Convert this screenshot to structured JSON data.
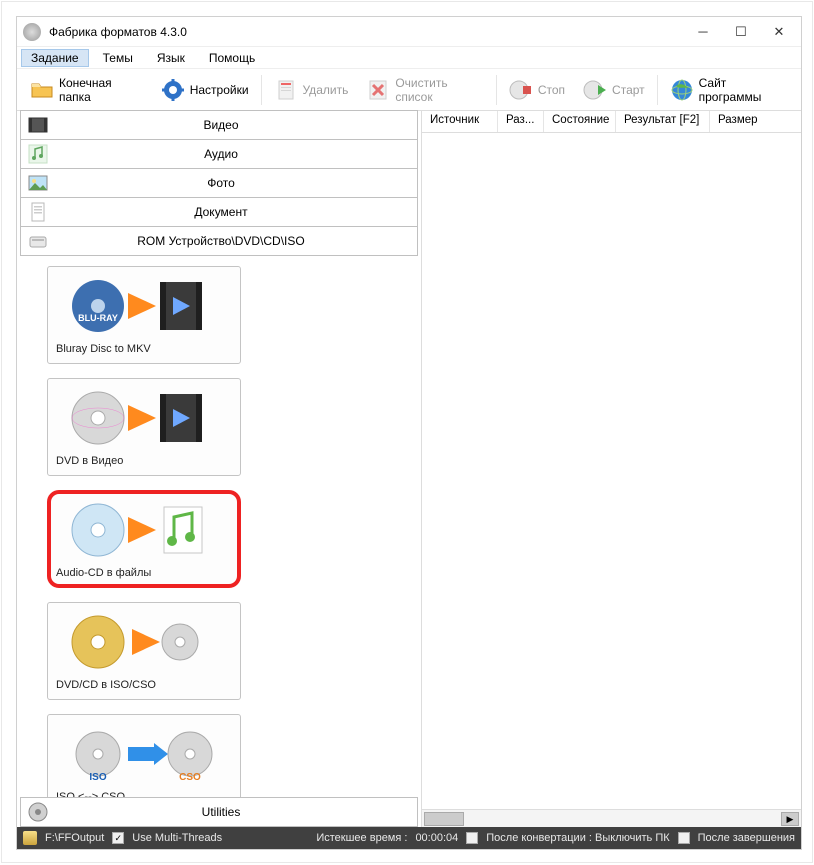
{
  "window": {
    "title": "Фабрика форматов 4.3.0"
  },
  "menu": {
    "task": "Задание",
    "themes": "Темы",
    "lang": "Язык",
    "help": "Помощь"
  },
  "toolbar": {
    "output_folder": "Конечная папка",
    "settings": "Настройки",
    "delete": "Удалить",
    "clear_list": "Очистить список",
    "stop": "Стоп",
    "start": "Старт",
    "website": "Сайт программы"
  },
  "accordion": {
    "video": "Видео",
    "audio": "Аудио",
    "photo": "Фото",
    "document": "Документ",
    "rom": "ROM Устройство\\DVD\\CD\\ISO",
    "utilities": "Utilities"
  },
  "rom_items": [
    {
      "label": "Bluray Disc to MKV",
      "kind": "bluray"
    },
    {
      "label": "DVD в Видео",
      "kind": "dvd"
    },
    {
      "label": "Audio-CD в файлы",
      "kind": "audiocd",
      "highlight": true
    },
    {
      "label": "DVD/CD в ISO/CSO",
      "kind": "dvdiso"
    },
    {
      "label": "ISO <--> CSO",
      "kind": "isocso"
    }
  ],
  "columns": {
    "source": "Источник",
    "size_in": "Раз...",
    "status": "Состояние",
    "result": "Результат [F2]",
    "size_out": "Размер"
  },
  "status": {
    "output_path": "F:\\FFOutput",
    "multithreads": "Use Multi-Threads",
    "elapsed_label": "Истекшее время :",
    "elapsed_value": "00:00:04",
    "after_conv": "После конвертации : Выключить ПК",
    "after_done": "После завершения"
  }
}
